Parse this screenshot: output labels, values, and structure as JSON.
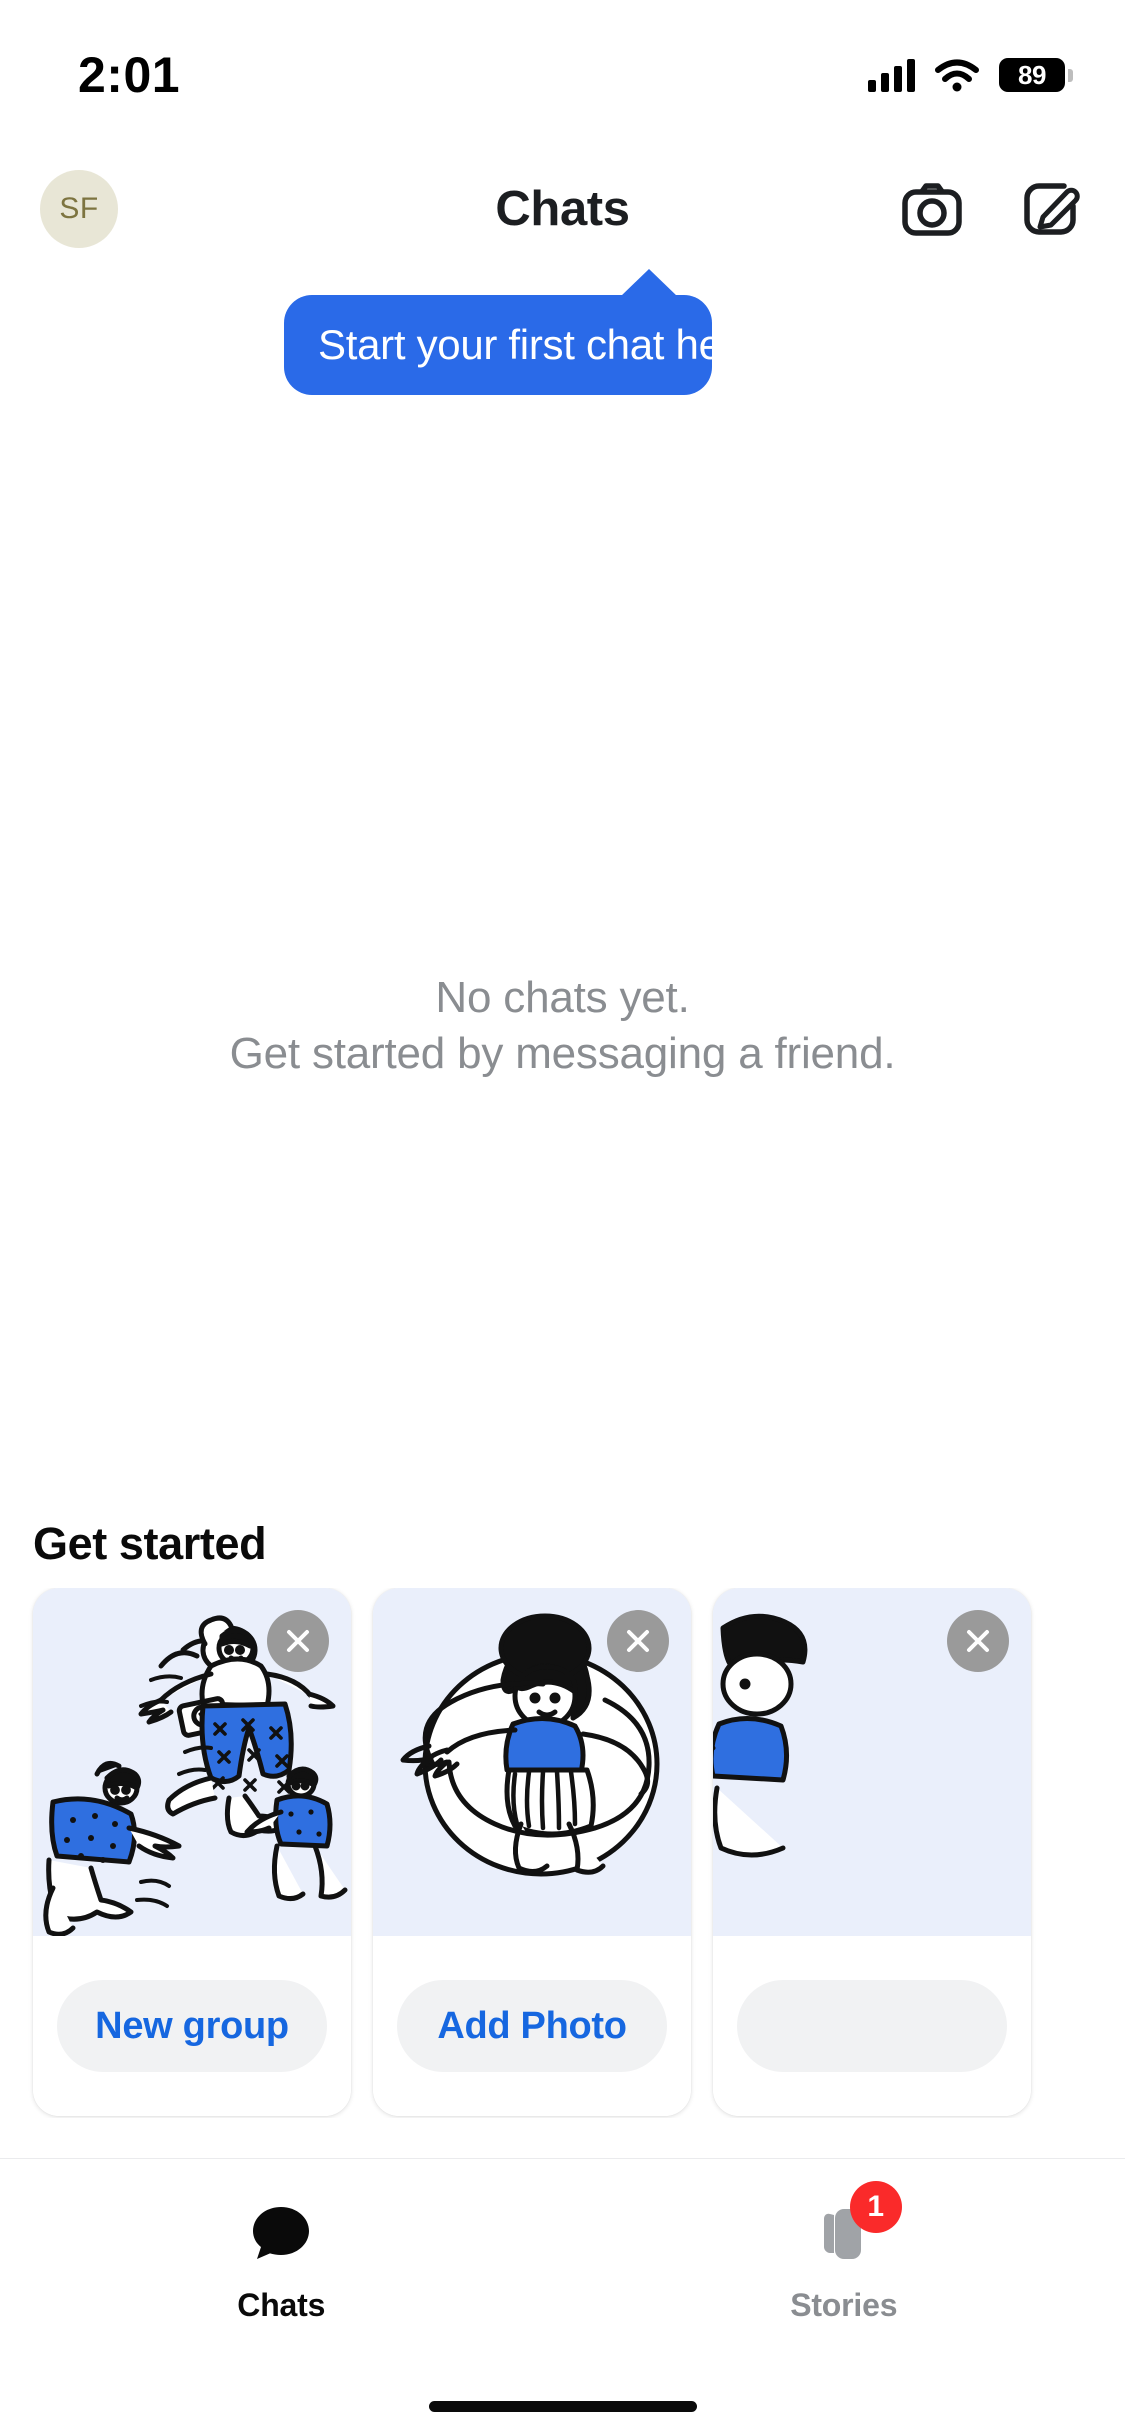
{
  "status_bar": {
    "time": "2:01",
    "battery_level": "89",
    "icons": [
      "cellular-signal-icon",
      "wifi-icon",
      "battery-icon"
    ]
  },
  "header": {
    "title": "Chats",
    "avatar_initials": "SF",
    "avatar_bg": "#e8e6d6",
    "avatar_fg": "#7d7440",
    "actions": [
      {
        "name": "camera-icon",
        "label": "Camera"
      },
      {
        "name": "compose-icon",
        "label": "New message"
      }
    ]
  },
  "tooltip": {
    "text": "Start your first chat here.",
    "color": "#2a6ae8"
  },
  "empty_state": {
    "line1": "No chats yet.",
    "line2": "Get started by messaging a friend.",
    "color": "#8a8d91"
  },
  "get_started": {
    "title": "Get started",
    "cards": [
      {
        "button_label": "New group",
        "close_label": "Dismiss",
        "art": "people-running-illustration"
      },
      {
        "button_label": "Add Photo",
        "close_label": "Dismiss",
        "art": "person-circle-illustration"
      },
      {
        "button_label": "",
        "close_label": "Dismiss",
        "art": "partial-card-illustration"
      }
    ],
    "button_color": "#1667e0",
    "art_bg": "#eaeffb"
  },
  "tab_bar": {
    "tabs": [
      {
        "label": "Chats",
        "icon": "chat-bubble-icon",
        "active": true,
        "badge": ""
      },
      {
        "label": "Stories",
        "icon": "stories-cards-icon",
        "active": false,
        "badge": "1"
      }
    ],
    "badge_color": "#fa2a2a"
  }
}
